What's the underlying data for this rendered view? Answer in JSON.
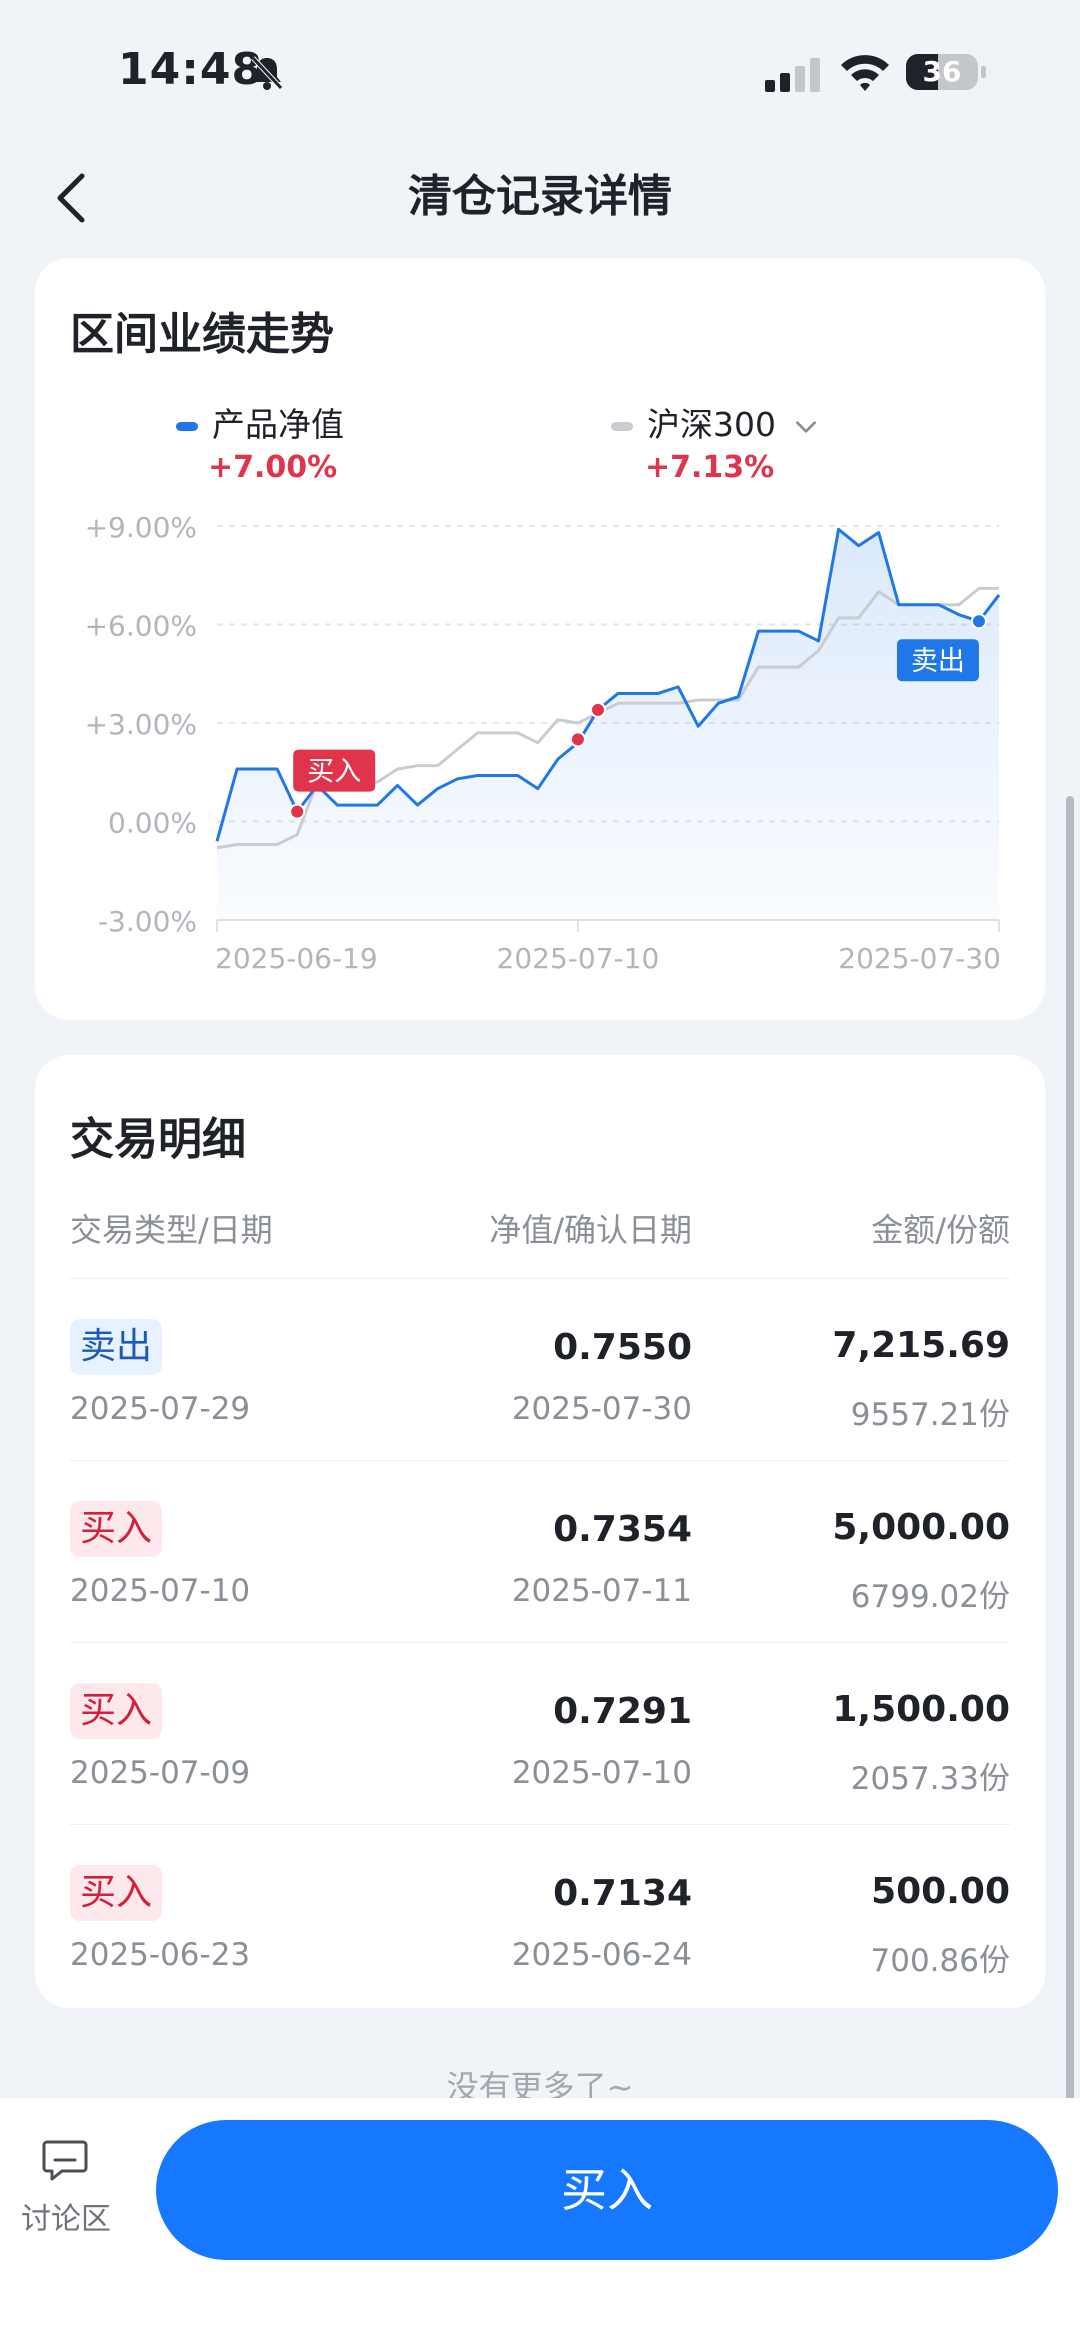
{
  "status_bar": {
    "time": "14:48",
    "battery": "36"
  },
  "nav": {
    "title": "清仓记录详情"
  },
  "performance": {
    "title": "区间业绩走势",
    "legend": [
      {
        "name": "产品净值",
        "value": "+7.00%",
        "color": "#1f77e8"
      },
      {
        "name": "沪深300",
        "value": "+7.13%",
        "color": "#c9ccd1"
      }
    ],
    "markers": {
      "buy_label": "买入",
      "sell_label": "卖出"
    }
  },
  "chart_data": {
    "type": "line",
    "ylim": [
      -3,
      9
    ],
    "y_ticks": [
      "+9.00%",
      "+6.00%",
      "+3.00%",
      "0.00%",
      "-3.00%"
    ],
    "x_ticks": [
      "2025-06-19",
      "2025-07-10",
      "2025-07-30"
    ],
    "x_count": 31,
    "series": [
      {
        "name": "产品净值",
        "color": "#1f77e8",
        "values": [
          -0.6,
          1.6,
          1.6,
          1.6,
          0.3,
          1.1,
          0.5,
          0.5,
          0.5,
          1.1,
          0.5,
          1.0,
          1.3,
          1.4,
          1.4,
          1.4,
          1.0,
          1.9,
          2.4,
          3.4,
          3.9,
          3.9,
          3.9,
          4.1,
          2.9,
          3.6,
          3.8,
          5.8,
          5.8,
          5.8,
          5.5,
          8.9,
          8.4,
          8.8,
          6.6,
          6.6,
          6.6,
          6.3,
          6.1,
          6.9
        ]
      },
      {
        "name": "沪深300",
        "color": "#c9ccd1",
        "values": [
          -0.8,
          -0.7,
          -0.7,
          -0.7,
          -0.4,
          1.2,
          1.2,
          1.2,
          1.2,
          1.6,
          1.7,
          1.7,
          2.2,
          2.7,
          2.7,
          2.7,
          2.4,
          3.1,
          3.0,
          3.3,
          3.6,
          3.6,
          3.6,
          3.6,
          3.7,
          3.7,
          3.7,
          4.7,
          4.7,
          4.7,
          5.2,
          6.2,
          6.2,
          7.0,
          6.6,
          6.6,
          6.6,
          6.6,
          7.1,
          7.1
        ]
      }
    ],
    "buy_points": [
      {
        "index": 4,
        "value": 0.3
      },
      {
        "index": 18,
        "value": 2.5
      },
      {
        "index": 19,
        "value": 3.4
      }
    ],
    "sell_points": [
      {
        "index": 38,
        "value": 6.1
      }
    ]
  },
  "trades": {
    "title": "交易明细",
    "headers": {
      "type_date": "交易类型/日期",
      "nav_confirm": "净值/确认日期",
      "amount_shares": "金额/份额"
    },
    "rows": [
      {
        "type": "卖出",
        "date": "2025-07-29",
        "nav": "0.7550",
        "confirm_date": "2025-07-30",
        "amount": "7,215.69",
        "shares": "9557.21份"
      },
      {
        "type": "买入",
        "date": "2025-07-10",
        "nav": "0.7354",
        "confirm_date": "2025-07-11",
        "amount": "5,000.00",
        "shares": "6799.02份"
      },
      {
        "type": "买入",
        "date": "2025-07-09",
        "nav": "0.7291",
        "confirm_date": "2025-07-10",
        "amount": "1,500.00",
        "shares": "2057.33份"
      },
      {
        "type": "买入",
        "date": "2025-06-23",
        "nav": "0.7134",
        "confirm_date": "2025-06-24",
        "amount": "500.00",
        "shares": "700.86份"
      }
    ]
  },
  "footer": {
    "no_more": "没有更多了~",
    "discuss_label": "讨论区",
    "buy_button": "买入"
  }
}
